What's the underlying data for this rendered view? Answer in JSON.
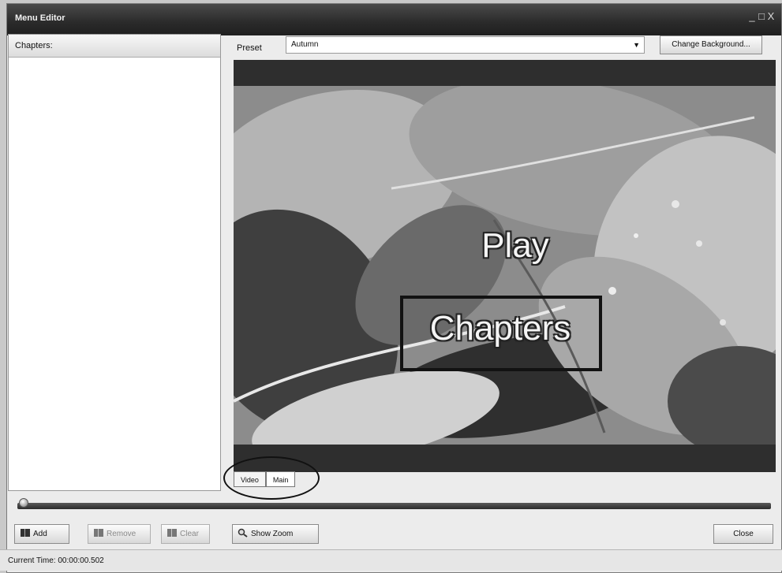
{
  "window": {
    "title": "Menu Editor",
    "controls": [
      "_",
      "□",
      "X"
    ]
  },
  "chapters_panel": {
    "header": "Chapters:"
  },
  "preset": {
    "label": "Preset",
    "value": "Autumn",
    "change_background_label": "Change Background..."
  },
  "preview": {
    "play_label": "Play",
    "chapters_label": "Chapters"
  },
  "tabs": [
    {
      "label": "Video",
      "active": false
    },
    {
      "label": "Main",
      "active": true
    }
  ],
  "timeline": {
    "position_fraction": 0.0
  },
  "toolbar": {
    "add_label": "Add",
    "remove_label": "Remove",
    "clear_label": "Clear",
    "show_zoom_label": "Show Zoom",
    "close_label": "Close"
  },
  "status": {
    "current_time": "Current Time: 00:00:00.502"
  },
  "icons": {
    "add": "book-add-icon",
    "remove": "book-remove-icon",
    "clear": "book-clear-icon",
    "zoom": "magnifier-icon",
    "dropdown": "chevron-down-icon"
  }
}
